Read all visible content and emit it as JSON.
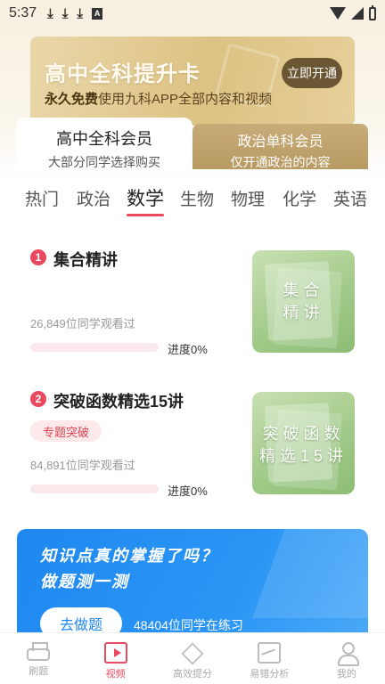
{
  "status_bar": {
    "time": "5:37",
    "notif_icon_label": "A"
  },
  "banner": {
    "title": "高中全科提升卡",
    "subtitle_strong": "永久免费",
    "subtitle_rest": "使用九科APP全部内容和视频",
    "button": "立即开通"
  },
  "member_tabs": [
    {
      "title": "高中全科会员",
      "subtitle": "大部分同学选择购买",
      "active": true
    },
    {
      "title": "政治单科会员",
      "subtitle": "仅开通政治的内容",
      "active": false
    }
  ],
  "subjects": [
    "热门",
    "政治",
    "数学",
    "生物",
    "物理",
    "化学",
    "英语"
  ],
  "active_subject": "数学",
  "courses": [
    {
      "number": "1",
      "title": "集合精讲",
      "views": "26,849位同学观看过",
      "progress_label": "进度0%",
      "progress": 0,
      "thumb_line1": "集合",
      "thumb_line2": "精讲"
    },
    {
      "number": "2",
      "title": "突破函数精选15讲",
      "tag": "专题突破",
      "views": "84,891位同学观看过",
      "progress_label": "进度0%",
      "progress": 0,
      "thumb_line1": "突破函数",
      "thumb_line2": "精选15讲"
    }
  ],
  "quiz": {
    "line1": "知识点真的掌握了吗？",
    "line2": "做题测一测",
    "button": "去做题",
    "count": "48404位同学在练习"
  },
  "bottom_nav": [
    {
      "label": "刷题",
      "icon": "printer-icon",
      "active": false
    },
    {
      "label": "视频",
      "icon": "video-icon",
      "active": true
    },
    {
      "label": "高效提分",
      "icon": "diamond-icon",
      "active": false
    },
    {
      "label": "易错分析",
      "icon": "chart-icon",
      "active": false
    },
    {
      "label": "我的",
      "icon": "user-icon",
      "active": false
    }
  ],
  "colors": {
    "accent": "#e84a5f",
    "gold": "#b89a62",
    "quiz_blue": "#1f88f0",
    "thumb_green": "#9fc987"
  }
}
